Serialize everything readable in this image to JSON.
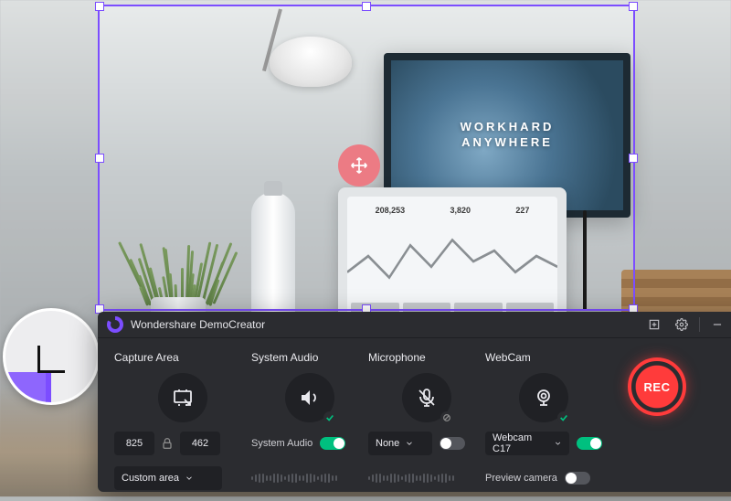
{
  "app": {
    "title": "Wondershare DemoCreator"
  },
  "backdrop": {
    "monitor_line1": "WORKHARD",
    "monitor_line2": "ANYWHERE",
    "laptop_stats": [
      "208,253",
      "3,820",
      "227"
    ]
  },
  "capture": {
    "label": "Capture Area",
    "width": "825",
    "height": "462",
    "mode": "Custom area"
  },
  "systemAudio": {
    "label": "System Audio",
    "device": "System Audio",
    "enabled": true
  },
  "microphone": {
    "label": "Microphone",
    "device": "None",
    "enabled": false
  },
  "webcam": {
    "label": "WebCam",
    "device": "Webcam C17",
    "enabled": true,
    "previewLabel": "Preview camera",
    "previewEnabled": false
  },
  "rec": {
    "label": "REC"
  }
}
